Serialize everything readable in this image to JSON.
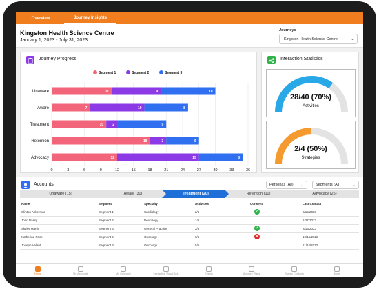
{
  "tabs": [
    {
      "label": "Overview",
      "active": false
    },
    {
      "label": "Journey Insights",
      "active": true
    }
  ],
  "header": {
    "title": "Kingston Health Science Centre",
    "date_range": "January 1, 2023 - July 31, 2023",
    "journeys_label": "Journeys",
    "journeys_value": "Kingston Health Science Centre"
  },
  "progress": {
    "title": "Journey Progress",
    "chart_data": {
      "type": "bar",
      "orientation": "horizontal",
      "stacked": true,
      "categories": [
        "Unaware",
        "Aware",
        "Treatment",
        "Retention",
        "Advocacy"
      ],
      "series": [
        {
          "name": "Segment 1",
          "color": "#f2657a",
          "values": [
            11,
            7,
            10,
            18,
            12
          ]
        },
        {
          "name": "Segment 2",
          "color": "#8c3ae6",
          "values": [
            9,
            10,
            2,
            3,
            15
          ]
        },
        {
          "name": "Segment 3",
          "color": "#2f6ff0",
          "values": [
            10,
            8,
            9,
            6,
            8
          ]
        }
      ],
      "xticks": [
        0,
        3,
        6,
        9,
        12,
        15,
        18,
        21,
        24,
        27,
        30,
        33,
        36
      ],
      "xlim": [
        0,
        36
      ],
      "legend": "top"
    }
  },
  "stats": {
    "title": "Interaction Statistics",
    "activities": {
      "value": "28/40 (70%)",
      "label": "Activities",
      "fraction": 0.7,
      "color": "#29a8e8"
    },
    "strategies": {
      "value": "2/4 (50%)",
      "label": "Strategies",
      "fraction": 0.5,
      "color": "#f49a2f"
    }
  },
  "accounts": {
    "title": "Accounts",
    "personas": "Personas (All)",
    "segments": "Segments (All)",
    "stages": [
      {
        "label": "Unaware (15)",
        "active": false
      },
      {
        "label": "Aware (30)",
        "active": false
      },
      {
        "label": "Treatment (20)",
        "active": true
      },
      {
        "label": "Retention (10)",
        "active": false
      },
      {
        "label": "Advocacy (25)",
        "active": false
      }
    ],
    "columns": [
      "Name",
      "Segment",
      "Specialty",
      "Activities",
      "Consent",
      "Last Contact"
    ],
    "rows": [
      {
        "name": "Clinton Ackerman",
        "segment": "Segment 1",
        "specialty": "Cardiology",
        "activities": "2/5",
        "consent": "yes",
        "last": "2/15/2023"
      },
      {
        "name": "John Bassy",
        "segment": "Segment 2",
        "specialty": "Neurology",
        "activities": "1/5",
        "consent": "",
        "last": "1/27/2023"
      },
      {
        "name": "Skyler Martin",
        "segment": "Segment 3",
        "specialty": "General Practice",
        "activities": "2/5",
        "consent": "yes",
        "last": "2/15/2023"
      },
      {
        "name": "Katherine Pace",
        "segment": "Segment 2",
        "specialty": "Oncology",
        "activities": "0/5",
        "consent": "no",
        "last": "12/15/2022"
      },
      {
        "name": "Joseph Valenti",
        "segment": "Segment 3",
        "specialty": "Oncology",
        "activities": "5/5",
        "consent": "",
        "last": "11/24/2022"
      }
    ]
  },
  "nav": [
    {
      "label": "Home",
      "active": true
    },
    {
      "label": "My Accounts",
      "active": false
    },
    {
      "label": "My Schedule",
      "active": false
    },
    {
      "label": "Interactive Visual Aids",
      "active": false
    },
    {
      "label": "Events",
      "active": false
    },
    {
      "label": "Account Plans",
      "active": false
    },
    {
      "label": "Survey Contacts",
      "active": false
    },
    {
      "label": "More",
      "active": false
    }
  ]
}
